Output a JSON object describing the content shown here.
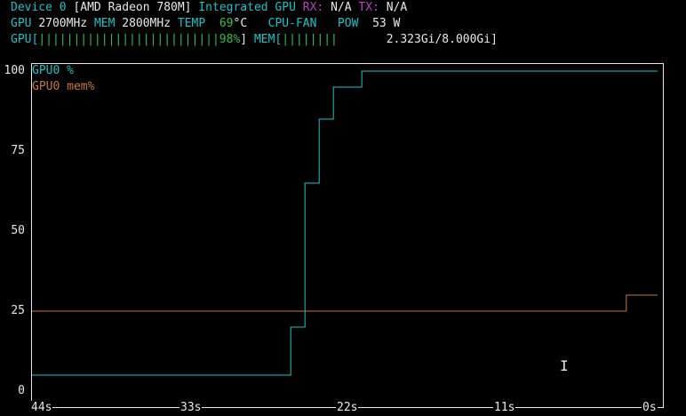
{
  "header": {
    "device_label": "Device 0",
    "device_name": "[AMD Radeon 780M]",
    "device_type": "Integrated GPU",
    "rx_label": "RX:",
    "rx_value": "N/A",
    "tx_label": "TX:",
    "tx_value": "N/A",
    "gpu_clock_label": "GPU",
    "gpu_clock_value": "2700MHz",
    "mem_clock_label": "MEM",
    "mem_clock_value": "2800MHz",
    "temp_label": "TEMP",
    "temp_value": "69",
    "temp_unit": "°C",
    "fan_label": "CPU-FAN",
    "pow_label": "POW",
    "pow_value": "53 W",
    "gpu_bar_label": "GPU[",
    "gpu_bar_fill": "||||||||||||||||||||||||||98%",
    "gpu_bar_close": "]",
    "gpu_util_fraction": 0.98,
    "mem_bar_label": "MEM[",
    "mem_bar_fill": "||||||||",
    "mem_bar_text": "2.323Gi/8.000Gi",
    "mem_bar_close": "]"
  },
  "colors": {
    "gpu_series": "#17c3c7",
    "mem_series": "#c8783a",
    "frame": "#e8e8e8",
    "background": "#000000"
  },
  "cursor_icon": "text-cursor-icon",
  "chart_data": {
    "type": "line",
    "ylim": [
      0,
      100
    ],
    "xlim": [
      44,
      0
    ],
    "yticks": [
      "100",
      "75",
      "50",
      "25",
      "0"
    ],
    "xticks": [
      "44s",
      "33s",
      "22s",
      "11s",
      "0s"
    ],
    "series": [
      {
        "name": "GPU0 %",
        "x": [
          44,
          25.8,
          25.8,
          24.8,
          24.8,
          23.8,
          23.8,
          22.8,
          22.8,
          20.8,
          20.8,
          0
        ],
        "values": [
          5,
          5,
          20,
          20,
          65,
          65,
          85,
          85,
          95,
          95,
          100,
          100
        ]
      },
      {
        "name": "GPU0 mem%",
        "x": [
          44,
          2.2,
          2.2,
          0
        ],
        "values": [
          25,
          25,
          30,
          30
        ]
      }
    ]
  }
}
